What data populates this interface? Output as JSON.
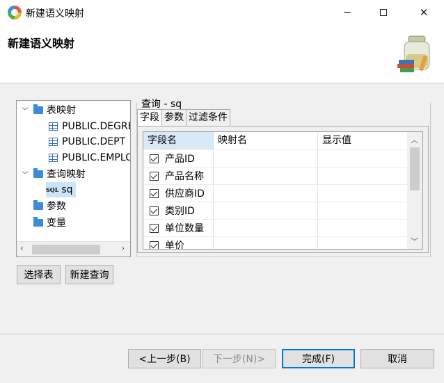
{
  "window": {
    "title": "新建语义映射",
    "minimize_icon": "minimize-icon",
    "maximize_icon": "maximize-icon",
    "close_icon": "close-icon"
  },
  "header": {
    "title": "新建语义映射"
  },
  "tree": {
    "nodes": [
      {
        "label": "表映射",
        "icon": "folder-icon",
        "expanded": true
      },
      {
        "label": "PUBLIC.DEGREE",
        "icon": "table-icon"
      },
      {
        "label": "PUBLIC.DEPT",
        "icon": "table-icon"
      },
      {
        "label": "PUBLIC.EMPLOYEE",
        "icon": "table-icon"
      },
      {
        "label": "查询映射",
        "icon": "folder-icon",
        "expanded": true
      },
      {
        "label": "sq",
        "icon": "sql-icon",
        "sql_badge": "SQL",
        "selected": true
      },
      {
        "label": "参数",
        "icon": "folder-icon"
      },
      {
        "label": "变量",
        "icon": "folder-icon"
      }
    ]
  },
  "query_panel": {
    "title": "查询 - sq",
    "tabs": [
      "字段",
      "参数",
      "过滤条件"
    ],
    "active_tab": "字段",
    "columns": [
      "字段名",
      "映射名",
      "显示值"
    ],
    "rows": [
      {
        "checked": true,
        "field": "产品ID",
        "mapping": "",
        "display": ""
      },
      {
        "checked": true,
        "field": "产品名称",
        "mapping": "",
        "display": ""
      },
      {
        "checked": true,
        "field": "供应商ID",
        "mapping": "",
        "display": ""
      },
      {
        "checked": true,
        "field": "类别ID",
        "mapping": "",
        "display": ""
      },
      {
        "checked": true,
        "field": "单位数量",
        "mapping": "",
        "display": ""
      },
      {
        "checked": true,
        "field": "单价",
        "mapping": "",
        "display": ""
      }
    ]
  },
  "actions": {
    "select_table": "选择表",
    "new_query": "新建查询"
  },
  "footer": {
    "prev": "<上一步(B)",
    "next": "下一步(N)>",
    "finish": "完成(F)",
    "cancel": "取消"
  },
  "colors": {
    "accent": "#0078d7",
    "folder": "#3c8ad8",
    "header_highlight": "#d8e9f8"
  }
}
